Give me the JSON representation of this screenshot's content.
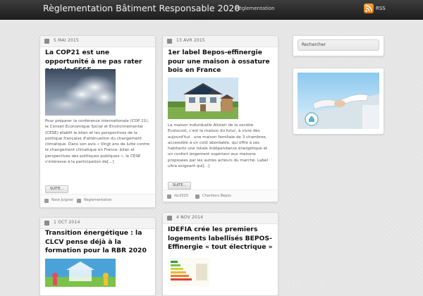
{
  "header": {
    "site_title": "Règlementation Bâtiment Responsable 2020",
    "nav": [
      {
        "label": "Règlementation"
      }
    ],
    "rss_label": "RSS"
  },
  "posts": [
    {
      "date": "5 MAI 2015",
      "title": "La COP21 est une opportunité à ne pas rater pour le CESE",
      "image": "cloudy-sky-photo",
      "excerpt": "Pour préparer la conférence internationale (COP 21), le Conseil Economique Social et Environnemental (CESE) établit le bilan et les perspectives de la politique française d'atténuation du changement climatique. Dans son avis « Vingt ans de lutte contre le changement climatique en France: bilan et perspectives des politiques publiques », le CESE s'intéresse à la participation de[...]",
      "more_label": "SUITE...",
      "author": "Rose Juigner",
      "category": "Règlementation"
    },
    {
      "date": "13 AVR 2015",
      "title": "1er label Bepos-effinergie pour une maison à ossature bois en France",
      "image": "house-with-solar-panels-photo",
      "excerpt": "La maison individuelle Alistair de la société Ecolocost, c'est la maison du futur, à vivre dès aujourd'hui : une maison familiale de 3 chambres, accessible à un coût abordable, qui offre à ses habitants une totale indépendance énergétique et un confort largement supérieur aux maisons proposées par les autres acteurs du marché. Label ultra exigeant qui[...]",
      "more_label": "SUITE...",
      "author": "rbr2020",
      "category": "Chantiers Bepos"
    },
    {
      "date": "1 OCT 2014",
      "title": "Transition énergétique : la CLCV pense déjà à la formation pour la RBR 2020",
      "image": "house-family-illustration"
    },
    {
      "date": "4 NOV 2014",
      "title": "IDEFIA crée les premiers logements labellisés BEPOS-Effinergie « tout électrique »",
      "image": "energy-chart-image"
    }
  ],
  "sidebar": {
    "search_placeholder": "Rechercher",
    "image": "handshake-illustration"
  }
}
